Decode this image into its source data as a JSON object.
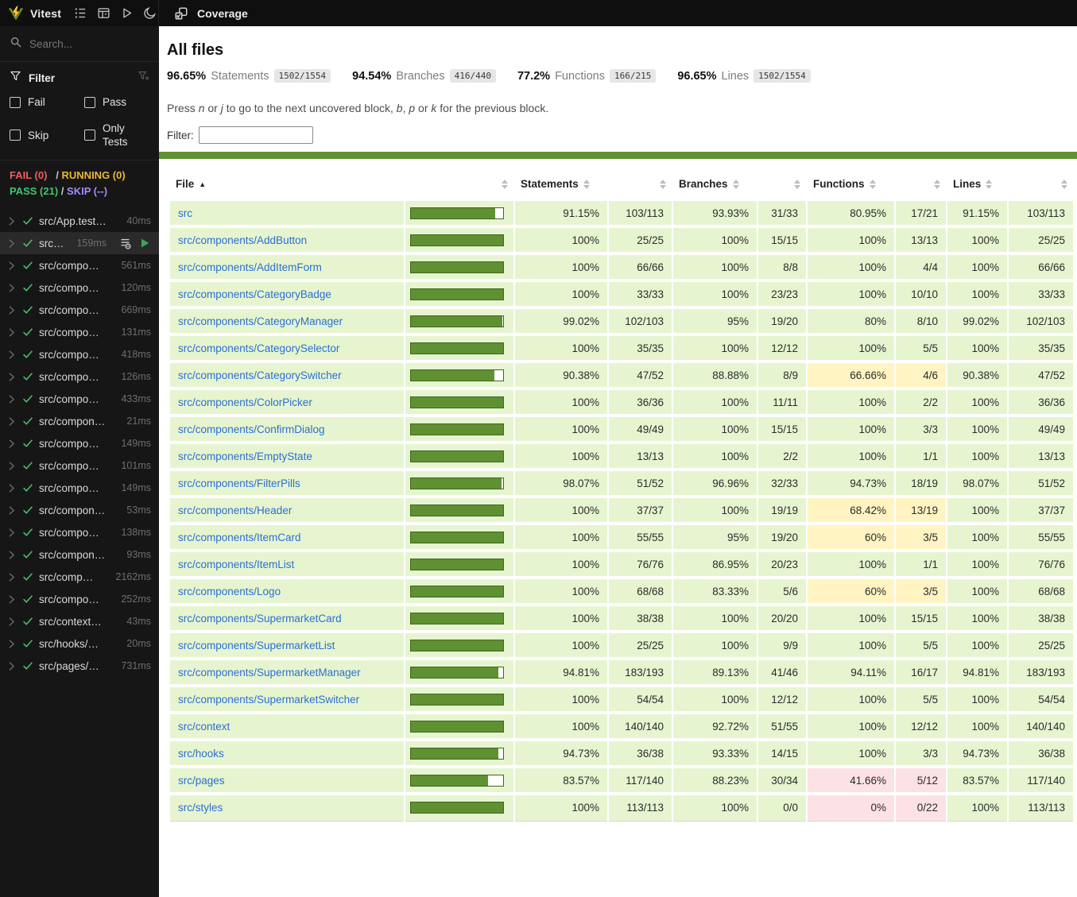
{
  "topbar": {
    "brand": "Vitest",
    "icons": [
      "tree-view-icon",
      "dashboard-icon",
      "run-all-icon",
      "dark-mode-icon"
    ],
    "coverage_tab": {
      "label": "Coverage",
      "icon": "coverage-report-icon"
    }
  },
  "sidebar": {
    "search_placeholder": "Search...",
    "filter": {
      "title": "Filter",
      "icon": "funnel-icon",
      "clear_icon": "clear-filter-icon",
      "options": [
        "Fail",
        "Pass",
        "Skip",
        "Only Tests"
      ]
    },
    "status": {
      "fail": "FAIL (0)",
      "running": "RUNNING (0)",
      "pass": "PASS (21)",
      "skip": "SKIP (--)",
      "sep": "/"
    },
    "tests": [
      {
        "name": "src/App.test…",
        "duration": "40ms"
      },
      {
        "name": "src…",
        "duration": "159ms",
        "active": true,
        "icons": [
          "task-list-icon",
          "run-test-icon"
        ]
      },
      {
        "name": "src/compo…",
        "duration": "561ms"
      },
      {
        "name": "src/compo…",
        "duration": "120ms"
      },
      {
        "name": "src/compo…",
        "duration": "669ms"
      },
      {
        "name": "src/compo…",
        "duration": "131ms"
      },
      {
        "name": "src/compo…",
        "duration": "418ms"
      },
      {
        "name": "src/compo…",
        "duration": "126ms"
      },
      {
        "name": "src/compo…",
        "duration": "433ms"
      },
      {
        "name": "src/compon…",
        "duration": "21ms"
      },
      {
        "name": "src/compo…",
        "duration": "149ms"
      },
      {
        "name": "src/compo…",
        "duration": "101ms"
      },
      {
        "name": "src/compo…",
        "duration": "149ms"
      },
      {
        "name": "src/compon…",
        "duration": "53ms"
      },
      {
        "name": "src/compo…",
        "duration": "138ms"
      },
      {
        "name": "src/compon…",
        "duration": "93ms"
      },
      {
        "name": "src/comp…",
        "duration": "2162ms"
      },
      {
        "name": "src/compo…",
        "duration": "252ms"
      },
      {
        "name": "src/context…",
        "duration": "43ms"
      },
      {
        "name": "src/hooks/…",
        "duration": "20ms"
      },
      {
        "name": "src/pages/…",
        "duration": "731ms"
      }
    ]
  },
  "main": {
    "title": "All files",
    "stats": [
      {
        "pct": "96.65%",
        "label": "Statements",
        "ratio": "1502/1554"
      },
      {
        "pct": "94.54%",
        "label": "Branches",
        "ratio": "416/440"
      },
      {
        "pct": "77.2%",
        "label": "Functions",
        "ratio": "166/215"
      },
      {
        "pct": "96.65%",
        "label": "Lines",
        "ratio": "1502/1554"
      }
    ],
    "hint_parts": [
      {
        "text": "Press "
      },
      {
        "text": "n",
        "italic": true
      },
      {
        "text": " or "
      },
      {
        "text": "j",
        "italic": true
      },
      {
        "text": " to go to the next uncovered block, "
      },
      {
        "text": "b",
        "italic": true
      },
      {
        "text": ", "
      },
      {
        "text": "p",
        "italic": true
      },
      {
        "text": " or "
      },
      {
        "text": "k",
        "italic": true
      },
      {
        "text": " for the previous block."
      }
    ],
    "filter_label": "Filter:",
    "filter_value": "",
    "overall_bar_pct": 96.65
  },
  "table": {
    "columns": [
      "File",
      "Statements",
      "Branches",
      "Functions",
      "Lines"
    ],
    "sort": {
      "column": "File",
      "direction": "asc"
    },
    "rows": [
      {
        "file": "src",
        "bar_pct": 91.15,
        "statements": {
          "pct": "91.15%",
          "abs": "103/113"
        },
        "branches": {
          "pct": "93.93%",
          "abs": "31/33"
        },
        "functions": {
          "pct": "80.95%",
          "abs": "17/21",
          "level": "high"
        },
        "lines": {
          "pct": "91.15%",
          "abs": "103/113"
        }
      },
      {
        "file": "src/components/AddButton",
        "bar_pct": 100,
        "statements": {
          "pct": "100%",
          "abs": "25/25"
        },
        "branches": {
          "pct": "100%",
          "abs": "15/15"
        },
        "functions": {
          "pct": "100%",
          "abs": "13/13",
          "level": "high"
        },
        "lines": {
          "pct": "100%",
          "abs": "25/25"
        }
      },
      {
        "file": "src/components/AddItemForm",
        "bar_pct": 100,
        "statements": {
          "pct": "100%",
          "abs": "66/66"
        },
        "branches": {
          "pct": "100%",
          "abs": "8/8"
        },
        "functions": {
          "pct": "100%",
          "abs": "4/4",
          "level": "high"
        },
        "lines": {
          "pct": "100%",
          "abs": "66/66"
        }
      },
      {
        "file": "src/components/CategoryBadge",
        "bar_pct": 100,
        "statements": {
          "pct": "100%",
          "abs": "33/33"
        },
        "branches": {
          "pct": "100%",
          "abs": "23/23"
        },
        "functions": {
          "pct": "100%",
          "abs": "10/10",
          "level": "high"
        },
        "lines": {
          "pct": "100%",
          "abs": "33/33"
        }
      },
      {
        "file": "src/components/CategoryManager",
        "bar_pct": 99.02,
        "statements": {
          "pct": "99.02%",
          "abs": "102/103"
        },
        "branches": {
          "pct": "95%",
          "abs": "19/20"
        },
        "functions": {
          "pct": "80%",
          "abs": "8/10",
          "level": "high"
        },
        "lines": {
          "pct": "99.02%",
          "abs": "102/103"
        }
      },
      {
        "file": "src/components/CategorySelector",
        "bar_pct": 100,
        "statements": {
          "pct": "100%",
          "abs": "35/35"
        },
        "branches": {
          "pct": "100%",
          "abs": "12/12"
        },
        "functions": {
          "pct": "100%",
          "abs": "5/5",
          "level": "high"
        },
        "lines": {
          "pct": "100%",
          "abs": "35/35"
        }
      },
      {
        "file": "src/components/CategorySwitcher",
        "bar_pct": 90.38,
        "statements": {
          "pct": "90.38%",
          "abs": "47/52"
        },
        "branches": {
          "pct": "88.88%",
          "abs": "8/9"
        },
        "functions": {
          "pct": "66.66%",
          "abs": "4/6",
          "level": "medium"
        },
        "lines": {
          "pct": "90.38%",
          "abs": "47/52"
        }
      },
      {
        "file": "src/components/ColorPicker",
        "bar_pct": 100,
        "statements": {
          "pct": "100%",
          "abs": "36/36"
        },
        "branches": {
          "pct": "100%",
          "abs": "11/11"
        },
        "functions": {
          "pct": "100%",
          "abs": "2/2",
          "level": "high"
        },
        "lines": {
          "pct": "100%",
          "abs": "36/36"
        }
      },
      {
        "file": "src/components/ConfirmDialog",
        "bar_pct": 100,
        "statements": {
          "pct": "100%",
          "abs": "49/49"
        },
        "branches": {
          "pct": "100%",
          "abs": "15/15"
        },
        "functions": {
          "pct": "100%",
          "abs": "3/3",
          "level": "high"
        },
        "lines": {
          "pct": "100%",
          "abs": "49/49"
        }
      },
      {
        "file": "src/components/EmptyState",
        "bar_pct": 100,
        "statements": {
          "pct": "100%",
          "abs": "13/13"
        },
        "branches": {
          "pct": "100%",
          "abs": "2/2"
        },
        "functions": {
          "pct": "100%",
          "abs": "1/1",
          "level": "high"
        },
        "lines": {
          "pct": "100%",
          "abs": "13/13"
        }
      },
      {
        "file": "src/components/FilterPills",
        "bar_pct": 98.07,
        "statements": {
          "pct": "98.07%",
          "abs": "51/52"
        },
        "branches": {
          "pct": "96.96%",
          "abs": "32/33"
        },
        "functions": {
          "pct": "94.73%",
          "abs": "18/19",
          "level": "high"
        },
        "lines": {
          "pct": "98.07%",
          "abs": "51/52"
        }
      },
      {
        "file": "src/components/Header",
        "bar_pct": 100,
        "statements": {
          "pct": "100%",
          "abs": "37/37"
        },
        "branches": {
          "pct": "100%",
          "abs": "19/19"
        },
        "functions": {
          "pct": "68.42%",
          "abs": "13/19",
          "level": "medium"
        },
        "lines": {
          "pct": "100%",
          "abs": "37/37"
        }
      },
      {
        "file": "src/components/ItemCard",
        "bar_pct": 100,
        "statements": {
          "pct": "100%",
          "abs": "55/55"
        },
        "branches": {
          "pct": "95%",
          "abs": "19/20"
        },
        "functions": {
          "pct": "60%",
          "abs": "3/5",
          "level": "medium"
        },
        "lines": {
          "pct": "100%",
          "abs": "55/55"
        }
      },
      {
        "file": "src/components/ItemList",
        "bar_pct": 100,
        "statements": {
          "pct": "100%",
          "abs": "76/76"
        },
        "branches": {
          "pct": "86.95%",
          "abs": "20/23"
        },
        "functions": {
          "pct": "100%",
          "abs": "1/1",
          "level": "high"
        },
        "lines": {
          "pct": "100%",
          "abs": "76/76"
        }
      },
      {
        "file": "src/components/Logo",
        "bar_pct": 100,
        "statements": {
          "pct": "100%",
          "abs": "68/68"
        },
        "branches": {
          "pct": "83.33%",
          "abs": "5/6"
        },
        "functions": {
          "pct": "60%",
          "abs": "3/5",
          "level": "medium"
        },
        "lines": {
          "pct": "100%",
          "abs": "68/68"
        }
      },
      {
        "file": "src/components/SupermarketCard",
        "bar_pct": 100,
        "statements": {
          "pct": "100%",
          "abs": "38/38"
        },
        "branches": {
          "pct": "100%",
          "abs": "20/20"
        },
        "functions": {
          "pct": "100%",
          "abs": "15/15",
          "level": "high"
        },
        "lines": {
          "pct": "100%",
          "abs": "38/38"
        }
      },
      {
        "file": "src/components/SupermarketList",
        "bar_pct": 100,
        "statements": {
          "pct": "100%",
          "abs": "25/25"
        },
        "branches": {
          "pct": "100%",
          "abs": "9/9"
        },
        "functions": {
          "pct": "100%",
          "abs": "5/5",
          "level": "high"
        },
        "lines": {
          "pct": "100%",
          "abs": "25/25"
        }
      },
      {
        "file": "src/components/SupermarketManager",
        "bar_pct": 94.81,
        "statements": {
          "pct": "94.81%",
          "abs": "183/193"
        },
        "branches": {
          "pct": "89.13%",
          "abs": "41/46"
        },
        "functions": {
          "pct": "94.11%",
          "abs": "16/17",
          "level": "high"
        },
        "lines": {
          "pct": "94.81%",
          "abs": "183/193"
        }
      },
      {
        "file": "src/components/SupermarketSwitcher",
        "bar_pct": 100,
        "statements": {
          "pct": "100%",
          "abs": "54/54"
        },
        "branches": {
          "pct": "100%",
          "abs": "12/12"
        },
        "functions": {
          "pct": "100%",
          "abs": "5/5",
          "level": "high"
        },
        "lines": {
          "pct": "100%",
          "abs": "54/54"
        }
      },
      {
        "file": "src/context",
        "bar_pct": 100,
        "statements": {
          "pct": "100%",
          "abs": "140/140"
        },
        "branches": {
          "pct": "92.72%",
          "abs": "51/55"
        },
        "functions": {
          "pct": "100%",
          "abs": "12/12",
          "level": "high"
        },
        "lines": {
          "pct": "100%",
          "abs": "140/140"
        }
      },
      {
        "file": "src/hooks",
        "bar_pct": 94.73,
        "statements": {
          "pct": "94.73%",
          "abs": "36/38"
        },
        "branches": {
          "pct": "93.33%",
          "abs": "14/15"
        },
        "functions": {
          "pct": "100%",
          "abs": "3/3",
          "level": "high"
        },
        "lines": {
          "pct": "94.73%",
          "abs": "36/38"
        }
      },
      {
        "file": "src/pages",
        "bar_pct": 83.57,
        "statements": {
          "pct": "83.57%",
          "abs": "117/140"
        },
        "branches": {
          "pct": "88.23%",
          "abs": "30/34"
        },
        "functions": {
          "pct": "41.66%",
          "abs": "5/12",
          "level": "low"
        },
        "lines": {
          "pct": "83.57%",
          "abs": "117/140"
        }
      },
      {
        "file": "src/styles",
        "bar_pct": 100,
        "statements": {
          "pct": "100%",
          "abs": "113/113"
        },
        "branches": {
          "pct": "100%",
          "abs": "0/0"
        },
        "functions": {
          "pct": "0%",
          "abs": "0/22",
          "level": "low"
        },
        "lines": {
          "pct": "100%",
          "abs": "113/113"
        }
      }
    ]
  },
  "colors": {
    "accent_green": "#5f9132",
    "row_high": "#e6f5d0",
    "cell_medium": "#fff4c2",
    "cell_low": "#fce1e5",
    "link_blue": "#2b6fd0",
    "fail_red": "#f25c5c",
    "running_yellow": "#e9b838",
    "pass_green": "#46c46d",
    "skip_purple": "#a78bfa",
    "logo_yellow": "#fcc72b",
    "logo_green": "#729b1b"
  }
}
